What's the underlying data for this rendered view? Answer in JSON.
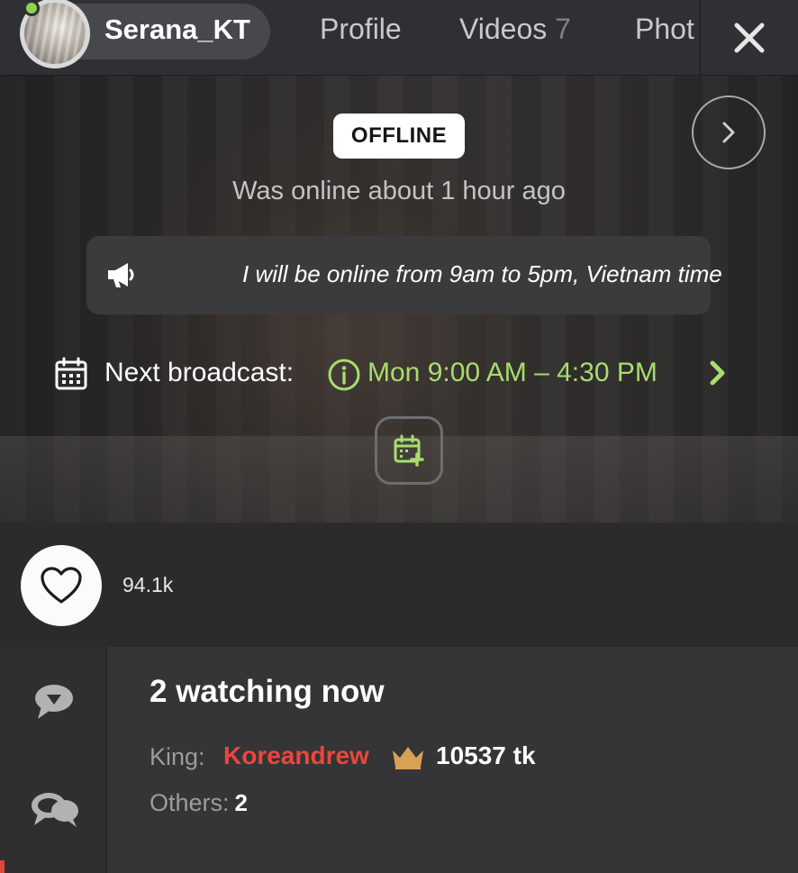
{
  "header": {
    "username": "Serana_KT",
    "tabs": [
      {
        "label": "Profile",
        "count": ""
      },
      {
        "label": "Videos",
        "count": "7"
      },
      {
        "label": "Phot",
        "count": ""
      }
    ],
    "close_icon": "close-icon"
  },
  "hero": {
    "status_badge": "OFFLINE",
    "last_seen": "Was online about 1 hour ago",
    "announcement": "I will be online from 9am to 5pm, Vietnam time",
    "next_broadcast_label": "Next broadcast:",
    "next_broadcast_time": "Mon 9:00 AM – 4:30 PM",
    "accent_color": "#a8dd6c"
  },
  "likes": {
    "count": "94.1k"
  },
  "chat": {
    "watching_title": "2 watching now",
    "king_label": "King:",
    "king_name": "Koreandrew",
    "king_tokens": "10537 tk",
    "others_label": "Others:",
    "others_count": "2",
    "king_color": "#e9473d"
  }
}
